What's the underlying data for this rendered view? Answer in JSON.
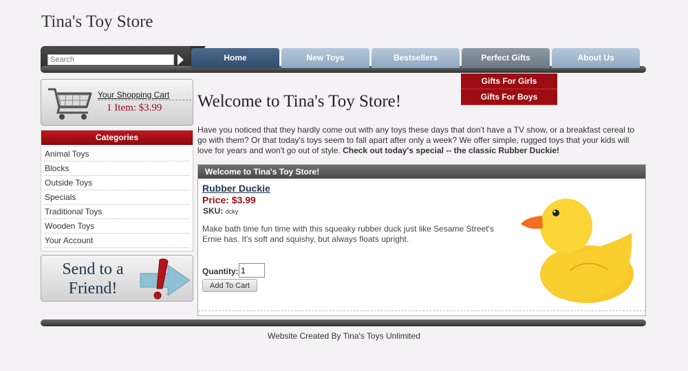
{
  "site": {
    "title": "Tina's Toy Store"
  },
  "search": {
    "placeholder": "Search"
  },
  "nav": {
    "tabs": [
      {
        "label": "Home",
        "state": "active"
      },
      {
        "label": "New Toys",
        "state": "normal"
      },
      {
        "label": "Bestsellers",
        "state": "normal"
      },
      {
        "label": "Perfect Gifts",
        "state": "hover"
      },
      {
        "label": "About Us",
        "state": "normal"
      }
    ],
    "dropdown": [
      "Gifts For Girls",
      "Gifts For Boys"
    ]
  },
  "cart": {
    "label": "Your Shopping Cart",
    "summary": "1 Item: $3.99"
  },
  "categories": {
    "heading": "Categories",
    "items": [
      "Animal Toys",
      "Blocks",
      "Outside Toys",
      "Specials",
      "Traditional Toys",
      "Wooden Toys",
      "Your Account"
    ]
  },
  "send_friend": {
    "line1": "Send to a",
    "line2": "Friend!"
  },
  "main": {
    "title": "Welcome to Tina's Toy Store!",
    "intro": "Have you noticed that they hardly come out with any toys these days that don't have a TV show, or a breakfast cereal to go with them? Or that today's toys seem to fall apart after only a week? We offer simple, rugged toys that your kids will love for years and won't go out of style. ",
    "intro_bold": "Check out today's special -- the classic Rubber Duckie!"
  },
  "product": {
    "panel_title": "Welcome to Tina's Toy Store!",
    "name": "Rubber Duckie",
    "price": "Price: $3.99",
    "sku_label": "SKU:",
    "sku": "dcky",
    "description": "Make bath time fun time with this squeaky rubber duck just like Sesame Street's Ernie has. It's soft and squishy, but always floats upright.",
    "quantity_label": "Quantity:",
    "quantity": "1",
    "add_label": "Add To Cart"
  },
  "footer": {
    "text": "Website Created By Tina's Toys Unlimited"
  },
  "colors": {
    "accent_red": "#9b0d12",
    "nav_blue": "#2f4d6e",
    "nav_light": "#9fb5cb"
  }
}
